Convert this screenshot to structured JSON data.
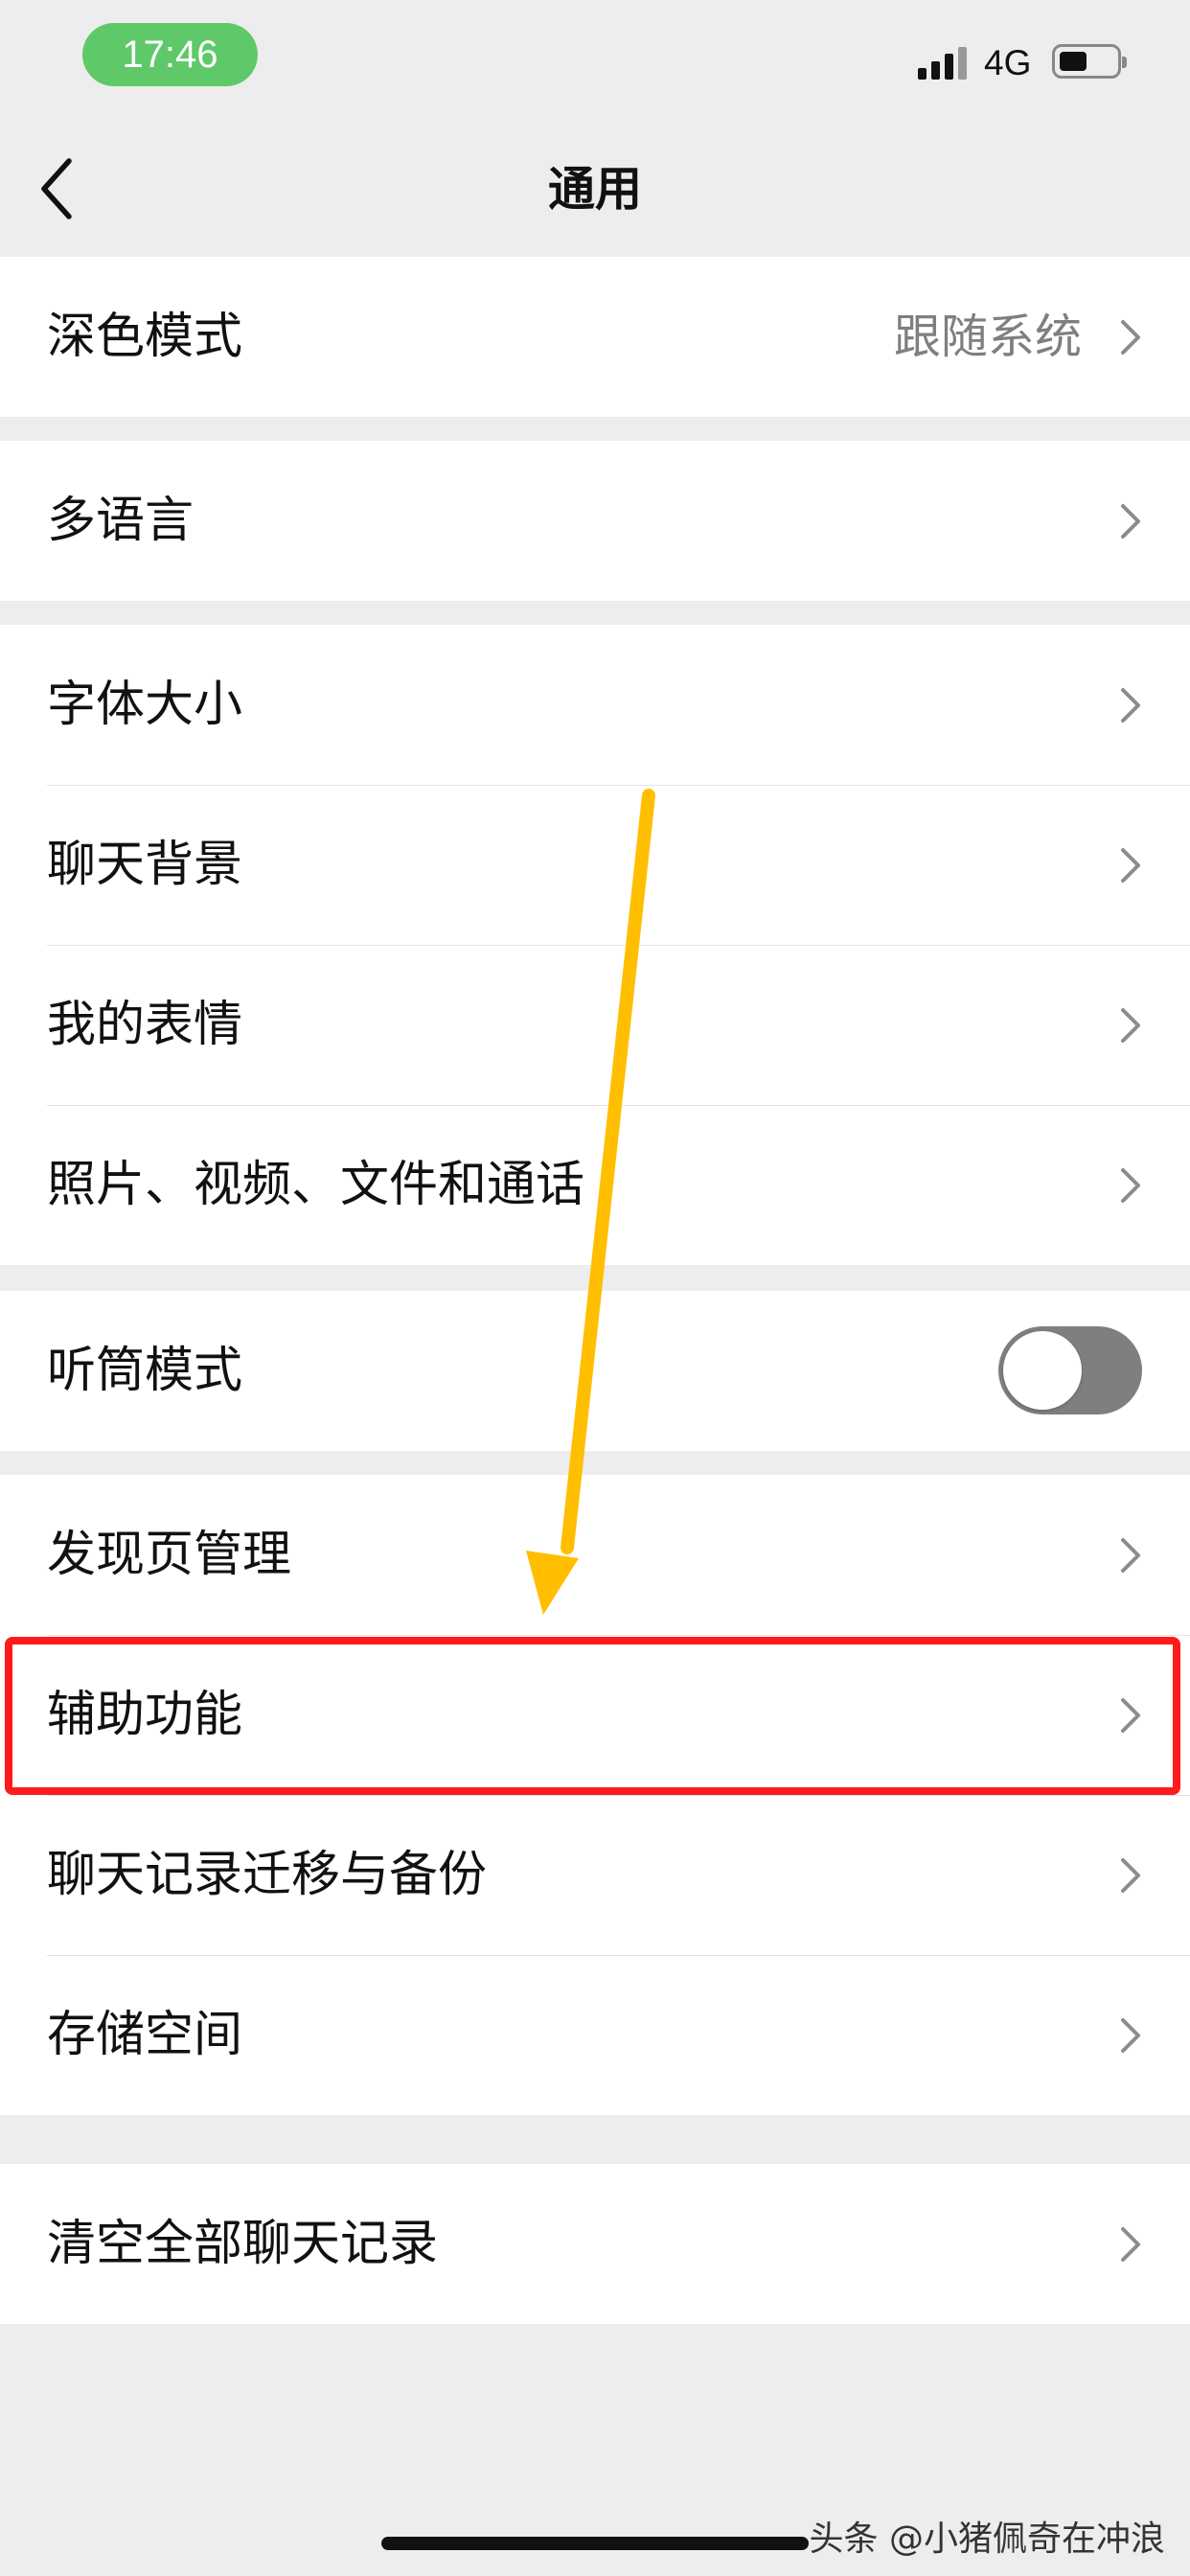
{
  "status_bar": {
    "time": "17:46",
    "network": "4G",
    "time_pill_color": "#5fc96a"
  },
  "nav": {
    "title": "通用",
    "back_icon": "chevron-left-icon"
  },
  "groups": [
    {
      "rows": [
        {
          "label": "深色模式",
          "value": "跟随系统",
          "type": "link"
        }
      ]
    },
    {
      "rows": [
        {
          "label": "多语言",
          "type": "link"
        }
      ]
    },
    {
      "rows": [
        {
          "label": "字体大小",
          "type": "link"
        },
        {
          "label": "聊天背景",
          "type": "link"
        },
        {
          "label": "我的表情",
          "type": "link"
        },
        {
          "label": "照片、视频、文件和通话",
          "type": "link"
        }
      ]
    },
    {
      "rows": [
        {
          "label": "听筒模式",
          "type": "toggle",
          "toggle_on": false
        }
      ]
    },
    {
      "rows": [
        {
          "label": "发现页管理",
          "type": "link"
        },
        {
          "label": "辅助功能",
          "type": "link",
          "highlighted": true
        },
        {
          "label": "聊天记录迁移与备份",
          "type": "link"
        },
        {
          "label": "存储空间",
          "type": "link"
        }
      ]
    },
    {
      "rows": [
        {
          "label": "清空全部聊天记录",
          "type": "link"
        }
      ]
    }
  ],
  "annotations": {
    "highlight_color": "#ff1b1b",
    "arrow_color": "#ffbf00"
  },
  "watermark": "头条 @小猪佩奇在冲浪"
}
